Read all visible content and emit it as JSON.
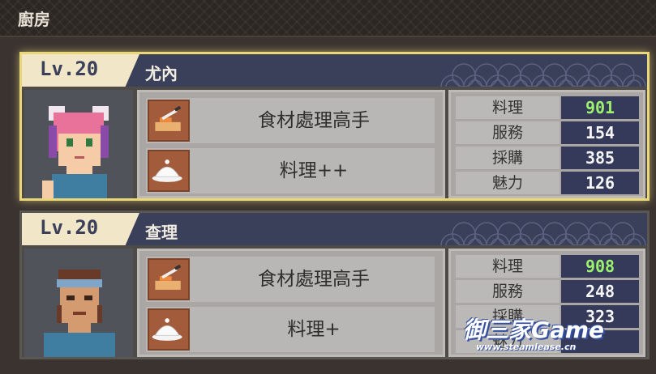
{
  "screen": {
    "title": "廚房"
  },
  "staff": [
    {
      "level": "Lv.20",
      "name": "尤內",
      "selected": true,
      "skills": [
        {
          "label": "食材處理高手",
          "icon": "knife-cutting-board-icon"
        },
        {
          "label": "料理++",
          "icon": "cloche-icon"
        }
      ],
      "stats": [
        {
          "label": "料理",
          "value": "901",
          "highlight": true
        },
        {
          "label": "服務",
          "value": "154"
        },
        {
          "label": "採購",
          "value": "385"
        },
        {
          "label": "魅力",
          "value": "126"
        }
      ]
    },
    {
      "level": "Lv.20",
      "name": "查理",
      "selected": false,
      "skills": [
        {
          "label": "食材處理高手",
          "icon": "knife-cutting-board-icon"
        },
        {
          "label": "料理+",
          "icon": "cloche-icon"
        }
      ],
      "stats": [
        {
          "label": "料理",
          "value": "908",
          "highlight": true
        },
        {
          "label": "服務",
          "value": "248"
        },
        {
          "label": "採購",
          "value": "323"
        },
        {
          "label": "魅力",
          "value": ""
        }
      ]
    }
  ],
  "watermark": {
    "text": "御三家Game",
    "url": "www.steamlease.cn"
  },
  "colors": {
    "highlight_value": "#9cf26c",
    "selected_border": "#e9d77a",
    "header_bg": "#3a3f5a"
  }
}
